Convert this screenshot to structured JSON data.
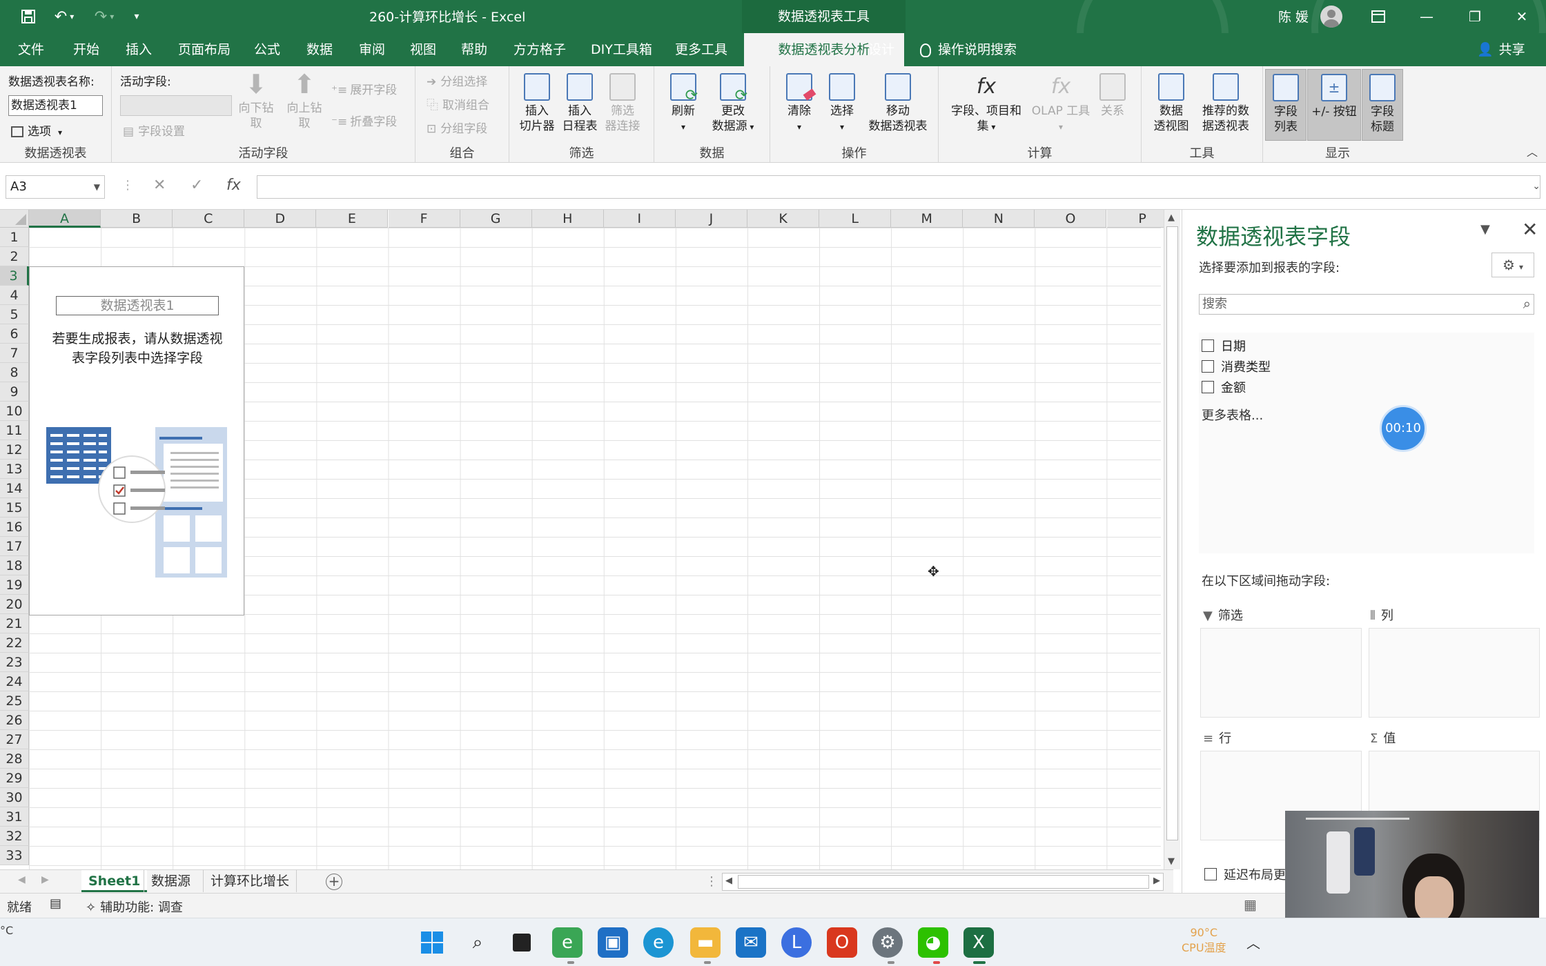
{
  "titlebar": {
    "doc_title": "260-计算环比增长  -  Excel",
    "context_tools": "数据透视表工具",
    "user_name": "陈 媛",
    "icons": {
      "save": "save-icon",
      "undo": "undo-icon",
      "redo": "redo-icon",
      "customize": "customize-qat-icon"
    }
  },
  "tabs": [
    "文件",
    "开始",
    "插入",
    "页面布局",
    "公式",
    "数据",
    "审阅",
    "视图",
    "帮助",
    "方方格子",
    "DIY工具箱",
    "更多工具",
    "数据透视表分析",
    "设计"
  ],
  "active_tab": "数据透视表分析",
  "tell_me": "操作说明搜索",
  "share": "共享",
  "ribbon": {
    "pivot_table": {
      "name_label": "数据透视表名称:",
      "name_value": "数据透视表1",
      "options": "选项",
      "group": "数据透视表"
    },
    "active_field": {
      "label": "活动字段:",
      "field_settings": "字段设置",
      "drill_down": [
        "向下钻",
        "取"
      ],
      "drill_up": [
        "向上钻",
        "取"
      ],
      "expand": "展开字段",
      "collapse": "折叠字段",
      "group": "活动字段"
    },
    "grouping": {
      "group_selection": "分组选择",
      "ungroup": "取消组合",
      "group_field": "分组字段",
      "group": "组合"
    },
    "filter": {
      "slicer": [
        "插入",
        "切片器"
      ],
      "timeline": [
        "插入",
        "日程表"
      ],
      "connections": [
        "筛选",
        "器连接"
      ],
      "group": "筛选"
    },
    "data": {
      "refresh": "刷新",
      "change_source": [
        "更改",
        "数据源"
      ],
      "group": "数据"
    },
    "actions": {
      "clear": "清除",
      "select": "选择",
      "move": [
        "移动",
        "数据透视表"
      ],
      "group": "操作"
    },
    "calculations": {
      "fields_items": [
        "字段、项目和",
        "集"
      ],
      "olap": "OLAP 工具",
      "relationships": "关系",
      "group": "计算"
    },
    "tools": {
      "pivot_chart": [
        "数据",
        "透视图"
      ],
      "recommended": [
        "推荐的数",
        "据透视表"
      ],
      "group": "工具"
    },
    "show": {
      "field_list": [
        "字段",
        "列表"
      ],
      "buttons": "+/- 按钮",
      "headers": [
        "字段",
        "标题"
      ],
      "group": "显示"
    }
  },
  "formula_bar": {
    "name_box": "A3",
    "formula": ""
  },
  "columns": [
    "A",
    "B",
    "C",
    "D",
    "E",
    "F",
    "G",
    "H",
    "I",
    "J",
    "K",
    "L",
    "M",
    "N",
    "O",
    "P"
  ],
  "rows": [
    "1",
    "2",
    "3",
    "4",
    "5",
    "6",
    "7",
    "8",
    "9",
    "10",
    "11",
    "12",
    "13",
    "14",
    "15",
    "16",
    "17",
    "18",
    "19",
    "20",
    "21",
    "22",
    "23",
    "24",
    "25",
    "26",
    "27",
    "28",
    "29",
    "30",
    "31",
    "32",
    "33"
  ],
  "selected_cell": {
    "column": "A",
    "row": "3"
  },
  "pivot_placeholder": {
    "name": "数据透视表1",
    "message_line1": "若要生成报表，请从数据透视",
    "message_line2": "表字段列表中选择字段"
  },
  "sheets": [
    "Sheet1",
    "数据源",
    "计算环比增长"
  ],
  "active_sheet": "Sheet1",
  "status": {
    "ready": "就绪",
    "accessibility": "辅助功能: 调查"
  },
  "field_pane": {
    "title": "数据透视表字段",
    "subtitle": "选择要添加到报表的字段:",
    "search_placeholder": "搜索",
    "fields": [
      {
        "label": "日期",
        "checked": false
      },
      {
        "label": "消费类型",
        "checked": false
      },
      {
        "label": "金额",
        "checked": false
      }
    ],
    "more_tables": "更多表格...",
    "timer": "00:10",
    "drag_hint": "在以下区域间拖动字段:",
    "areas": {
      "filters": "筛选",
      "columns": "列",
      "rows": "行",
      "values": "值"
    },
    "defer": "延迟布局更"
  },
  "taskbar": {
    "temp": "90°C",
    "cpu": "CPU温度",
    "left_partial": "°C"
  }
}
